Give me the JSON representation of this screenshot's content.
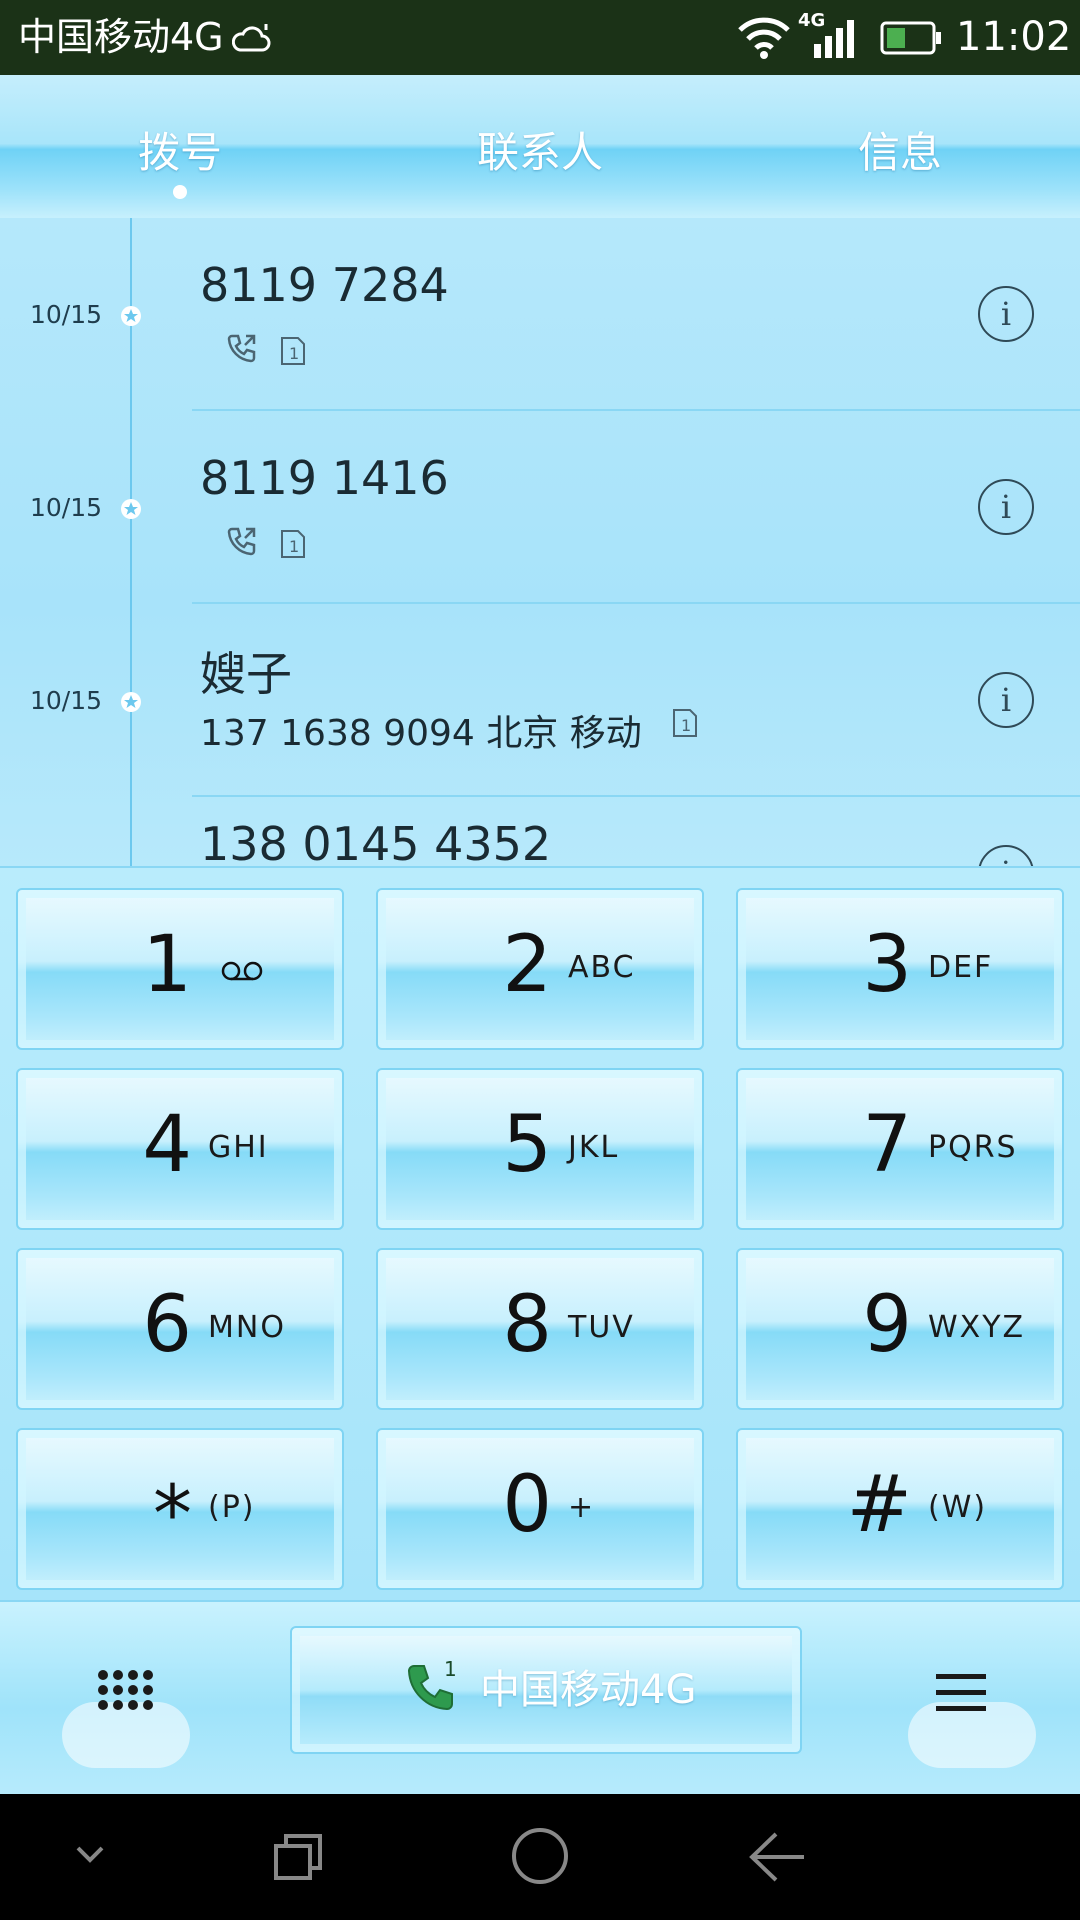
{
  "status_bar": {
    "carrier": "中国移动4G",
    "network_type": "4G",
    "time": "11:02"
  },
  "tabs": [
    {
      "label": "拨号",
      "selected": true
    },
    {
      "label": "联系人",
      "selected": false
    },
    {
      "label": "信息",
      "selected": false
    }
  ],
  "call_log": [
    {
      "date": "10/15",
      "title": "8119 7284",
      "subtitle": "",
      "call_type": "outgoing"
    },
    {
      "date": "10/15",
      "title": "8119 1416",
      "subtitle": "",
      "call_type": "outgoing"
    },
    {
      "date": "10/15",
      "title": "嫂子",
      "subtitle": "137 1638 9094  北京 移动",
      "call_type": ""
    },
    {
      "date": "",
      "title": "138 0145 4352",
      "subtitle": "",
      "call_type": ""
    }
  ],
  "keypad": [
    {
      "digit": "1",
      "letters": ""
    },
    {
      "digit": "2",
      "letters": "ABC"
    },
    {
      "digit": "3",
      "letters": "DEF"
    },
    {
      "digit": "4",
      "letters": "GHI"
    },
    {
      "digit": "5",
      "letters": "JKL"
    },
    {
      "digit": "7",
      "letters": "PQRS"
    },
    {
      "digit": "6",
      "letters": "MNO"
    },
    {
      "digit": "8",
      "letters": "TUV"
    },
    {
      "digit": "9",
      "letters": "WXYZ"
    },
    {
      "digit": "*",
      "letters": "(P)"
    },
    {
      "digit": "0",
      "letters": "+"
    },
    {
      "digit": "#",
      "letters": "(W)"
    }
  ],
  "action_bar": {
    "call_label": "中国移动4G",
    "sim_number": "1"
  },
  "theme": {
    "accent": "#7fd4f3",
    "status_bar_bg": "#1b3217",
    "call_green": "#2e9a4e"
  }
}
